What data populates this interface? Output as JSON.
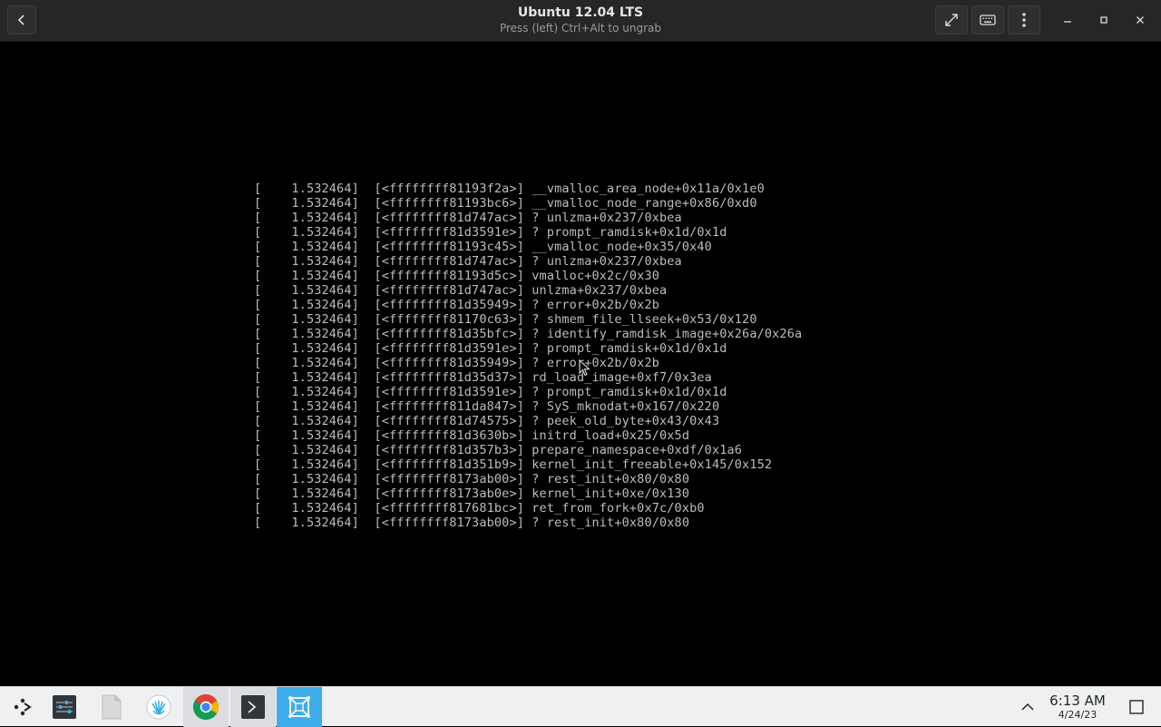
{
  "window": {
    "title": "Ubuntu 12.04 LTS",
    "subtitle": "Press (left) Ctrl+Alt to ungrab"
  },
  "icons": {
    "back": "chevron-left-icon",
    "fullscreen": "expand-icon",
    "keyboard": "keyboard-icon",
    "menu": "kebab-menu-icon",
    "minimize": "minimize-icon",
    "maximize": "maximize-icon",
    "close": "close-icon"
  },
  "console": {
    "lines": [
      "[    1.532464]  [<ffffffff81193f2a>] __vmalloc_area_node+0x11a/0x1e0",
      "[    1.532464]  [<ffffffff81193bc6>] __vmalloc_node_range+0x86/0xd0",
      "[    1.532464]  [<ffffffff81d747ac>] ? unlzma+0x237/0xbea",
      "[    1.532464]  [<ffffffff81d3591e>] ? prompt_ramdisk+0x1d/0x1d",
      "[    1.532464]  [<ffffffff81193c45>] __vmalloc_node+0x35/0x40",
      "[    1.532464]  [<ffffffff81d747ac>] ? unlzma+0x237/0xbea",
      "[    1.532464]  [<ffffffff81193d5c>] vmalloc+0x2c/0x30",
      "[    1.532464]  [<ffffffff81d747ac>] unlzma+0x237/0xbea",
      "[    1.532464]  [<ffffffff81d35949>] ? error+0x2b/0x2b",
      "[    1.532464]  [<ffffffff81170c63>] ? shmem_file_llseek+0x53/0x120",
      "[    1.532464]  [<ffffffff81d35bfc>] ? identify_ramdisk_image+0x26a/0x26a",
      "[    1.532464]  [<ffffffff81d3591e>] ? prompt_ramdisk+0x1d/0x1d",
      "[    1.532464]  [<ffffffff81d35949>] ? error+0x2b/0x2b",
      "[    1.532464]  [<ffffffff81d35d37>] rd_load_image+0xf7/0x3ea",
      "[    1.532464]  [<ffffffff81d3591e>] ? prompt_ramdisk+0x1d/0x1d",
      "[    1.532464]  [<ffffffff811da847>] ? SyS_mknodat+0x167/0x220",
      "[    1.532464]  [<ffffffff81d74575>] ? peek_old_byte+0x43/0x43",
      "[    1.532464]  [<ffffffff81d3630b>] initrd_load+0x25/0x5d",
      "[    1.532464]  [<ffffffff81d357b3>] prepare_namespace+0xdf/0x1a6",
      "[    1.532464]  [<ffffffff81d351b9>] kernel_init_freeable+0x145/0x152",
      "[    1.532464]  [<ffffffff8173ab00>] ? rest_init+0x80/0x80",
      "[    1.532464]  [<ffffffff8173ab0e>] kernel_init+0xe/0x130",
      "[    1.532464]  [<ffffffff817681bc>] ret_from_fork+0x7c/0xb0",
      "[    1.532464]  [<ffffffff8173ab00>] ? rest_init+0x80/0x80"
    ]
  },
  "taskbar": {
    "items": [
      {
        "name": "application-launcher",
        "icon": "launcher-icon"
      },
      {
        "name": "system-settings",
        "icon": "settings-sliders-icon"
      },
      {
        "name": "file-manager",
        "icon": "file-icon"
      },
      {
        "name": "app-store",
        "icon": "shell-icon"
      },
      {
        "name": "chrome",
        "icon": "chrome-icon"
      },
      {
        "name": "terminal",
        "icon": "terminal-icon"
      },
      {
        "name": "virtual-machine",
        "icon": "vm-icon"
      }
    ],
    "clock": {
      "time": "6:13 AM",
      "date": "4/24/23"
    }
  },
  "colors": {
    "titlebar": "#262626",
    "console_text": "#bdbdbd",
    "taskbar": "#eff0f1",
    "active_task": "#3daee9"
  }
}
